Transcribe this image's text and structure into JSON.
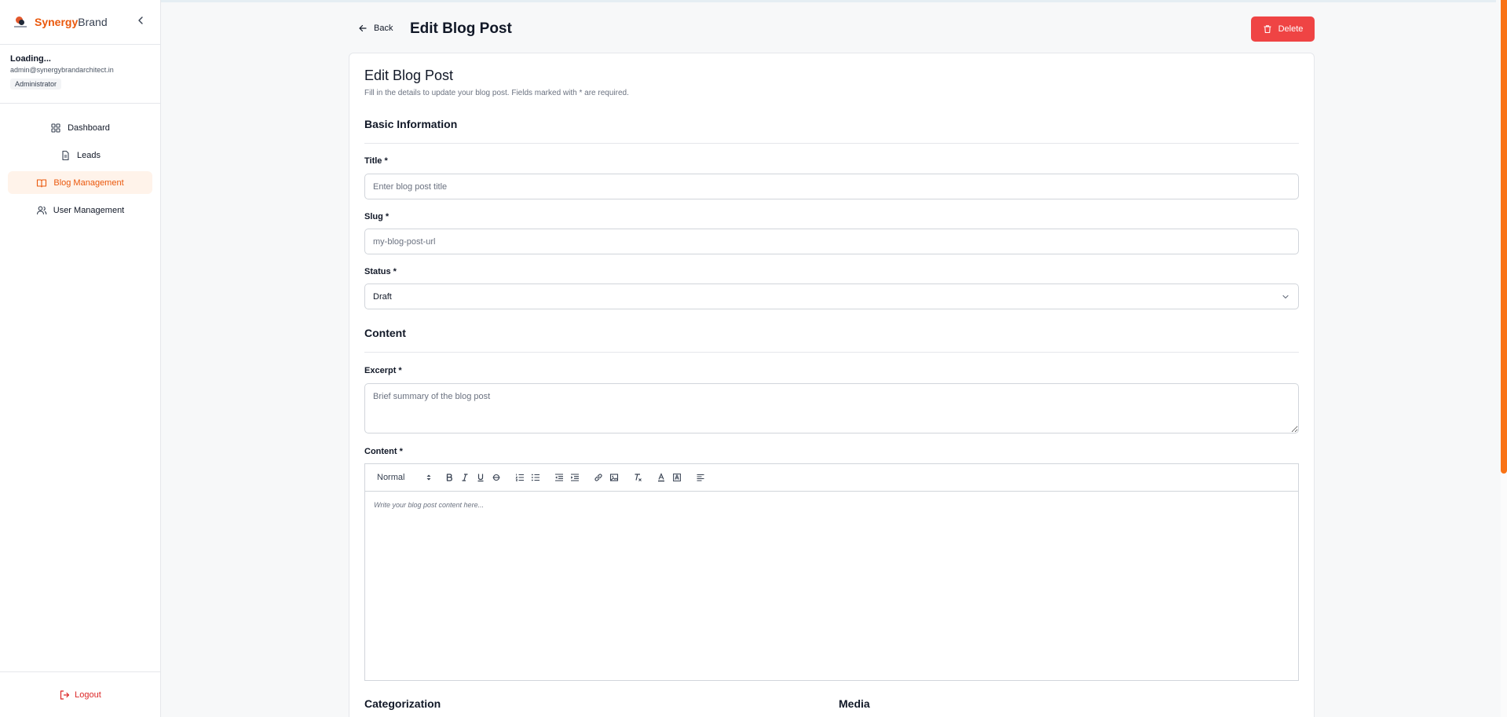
{
  "brand": {
    "name_a": "Synergy",
    "name_b": "Brand"
  },
  "user": {
    "name": "Loading...",
    "email": "admin@synergybrandarchitect.in",
    "role": "Administrator"
  },
  "nav": [
    {
      "label": "Dashboard",
      "icon": "grid-icon",
      "active": false
    },
    {
      "label": "Leads",
      "icon": "file-icon",
      "active": false
    },
    {
      "label": "Blog Management",
      "icon": "book-icon",
      "active": true
    },
    {
      "label": "User Management",
      "icon": "users-icon",
      "active": false
    }
  ],
  "logout_label": "Logout",
  "header": {
    "back_label": "Back",
    "title": "Edit Blog Post",
    "delete_label": "Delete"
  },
  "form": {
    "title": "Edit Blog Post",
    "subtitle": "Fill in the details to update your blog post. Fields marked with * are required.",
    "section_basic": "Basic Information",
    "title_label": "Title *",
    "title_placeholder": "Enter blog post title",
    "slug_label": "Slug *",
    "slug_placeholder": "my-blog-post-url",
    "status_label": "Status *",
    "status_value": "Draft",
    "section_content": "Content",
    "excerpt_label": "Excerpt *",
    "excerpt_placeholder": "Brief summary of the blog post",
    "content_label": "Content *",
    "editor_heading_select": "Normal",
    "editor_placeholder": "Write your blog post content here...",
    "section_categorization": "Categorization",
    "section_media": "Media"
  },
  "colors": {
    "accent": "#ea580c",
    "danger": "#ef4444",
    "scroll_thumb": "#f97316"
  }
}
